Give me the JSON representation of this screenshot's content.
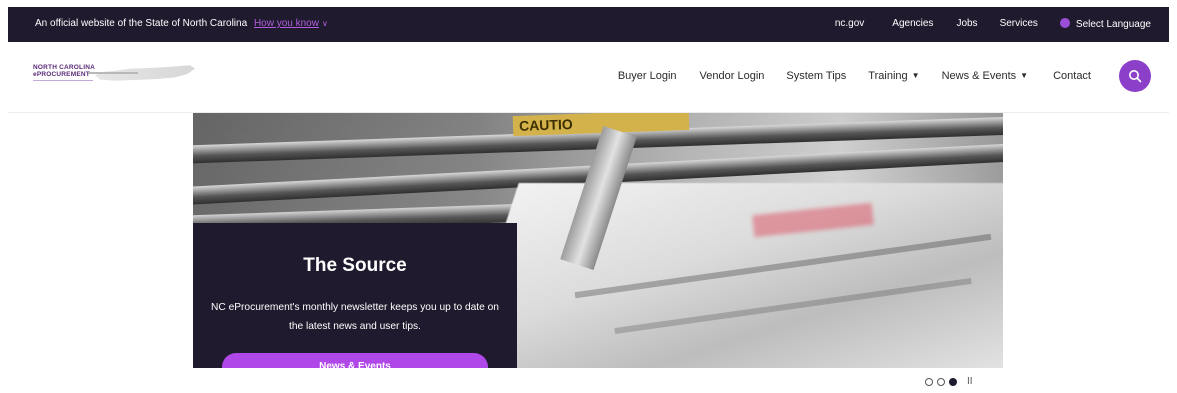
{
  "gov_bar": {
    "official_text": "An official website of the State of North Carolina",
    "how_you_know": "How you know",
    "links": {
      "ncgov": "nc.gov",
      "agencies": "Agencies",
      "jobs": "Jobs",
      "services": "Services",
      "language": "Select Language"
    }
  },
  "logo": {
    "line1": "NORTH CAROLINA",
    "line2": "ePROCUREMENT"
  },
  "nav": {
    "items": [
      {
        "label": "Buyer Login",
        "dropdown": false
      },
      {
        "label": "Vendor Login",
        "dropdown": false
      },
      {
        "label": "System Tips",
        "dropdown": false
      },
      {
        "label": "Training",
        "dropdown": true
      },
      {
        "label": "News & Events",
        "dropdown": true
      },
      {
        "label": "Contact",
        "dropdown": false
      }
    ]
  },
  "hero": {
    "image_text": "CAUTIO",
    "title": "The Source",
    "description": "NC eProcurement's monthly newsletter keeps you up to date on the latest news and user tips.",
    "button_label": "News & Events"
  },
  "carousel": {
    "slides_count": 3,
    "active_index": 2,
    "pause_symbol": "II"
  },
  "colors": {
    "dark": "#1f1a2d",
    "accent": "#8c3fc9",
    "button": "#b047e9"
  }
}
